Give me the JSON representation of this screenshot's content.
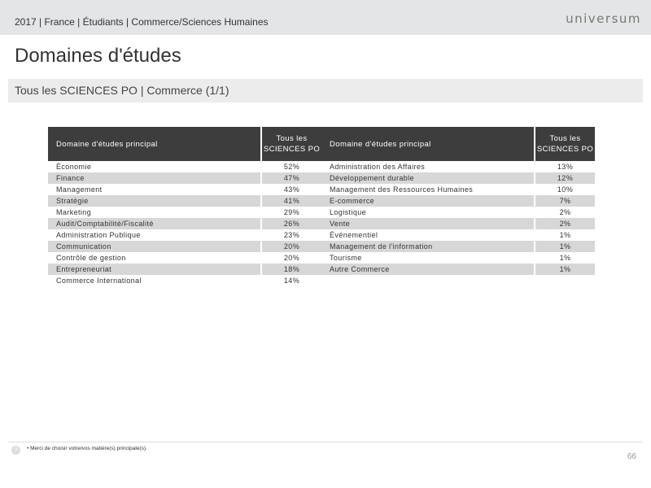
{
  "header": {
    "breadcrumb": "2017 | France | Étudiants | Commerce/Sciences Humaines",
    "logo_text": "universum"
  },
  "title": "Domaines d'études",
  "subtitle": "Tous les SCIENCES PO | Commerce (1/1)",
  "table_left": {
    "col_domain": "Domaine d'études principal",
    "col_pct_line1": "Tous les",
    "col_pct_line2": "SCIENCES PO",
    "rows": [
      {
        "domain": "Économie",
        "pct": "52%"
      },
      {
        "domain": "Finance",
        "pct": "47%"
      },
      {
        "domain": "Management",
        "pct": "43%"
      },
      {
        "domain": "Stratégie",
        "pct": "41%"
      },
      {
        "domain": "Marketing",
        "pct": "29%"
      },
      {
        "domain": "Audit/Comptabilité/Fiscalité",
        "pct": "26%"
      },
      {
        "domain": "Administration Publique",
        "pct": "23%"
      },
      {
        "domain": "Communication",
        "pct": "20%"
      },
      {
        "domain": "Contrôle de gestion",
        "pct": "20%"
      },
      {
        "domain": "Entrepreneuriat",
        "pct": "18%"
      },
      {
        "domain": "Commerce International",
        "pct": "14%"
      }
    ]
  },
  "table_right": {
    "col_domain": "Domaine d'études principal",
    "col_pct_line1": "Tous les",
    "col_pct_line2": "SCIENCES PO",
    "rows": [
      {
        "domain": "Administration des Affaires",
        "pct": "13%"
      },
      {
        "domain": "Développement durable",
        "pct": "12%"
      },
      {
        "domain": "Management des Ressources Humaines",
        "pct": "10%"
      },
      {
        "domain": "E-commerce",
        "pct": "7%"
      },
      {
        "domain": "Logistique",
        "pct": "2%"
      },
      {
        "domain": "Vente",
        "pct": "2%"
      },
      {
        "domain": "Événementiel",
        "pct": "1%"
      },
      {
        "domain": "Management de l'information",
        "pct": "1%"
      },
      {
        "domain": "Tourisme",
        "pct": "1%"
      },
      {
        "domain": "Autre Commerce",
        "pct": "1%"
      }
    ]
  },
  "footer": {
    "help_icon": "question-circle-icon",
    "help_glyph": "?",
    "footnote": "•  Merci de choisir votre/vos matière(s) principale(s).",
    "page_number": "66"
  },
  "colors": {
    "header_bar": "#e4e5e6",
    "table_header": "#3d3d3d",
    "row_alt": "#d7d7d7"
  }
}
